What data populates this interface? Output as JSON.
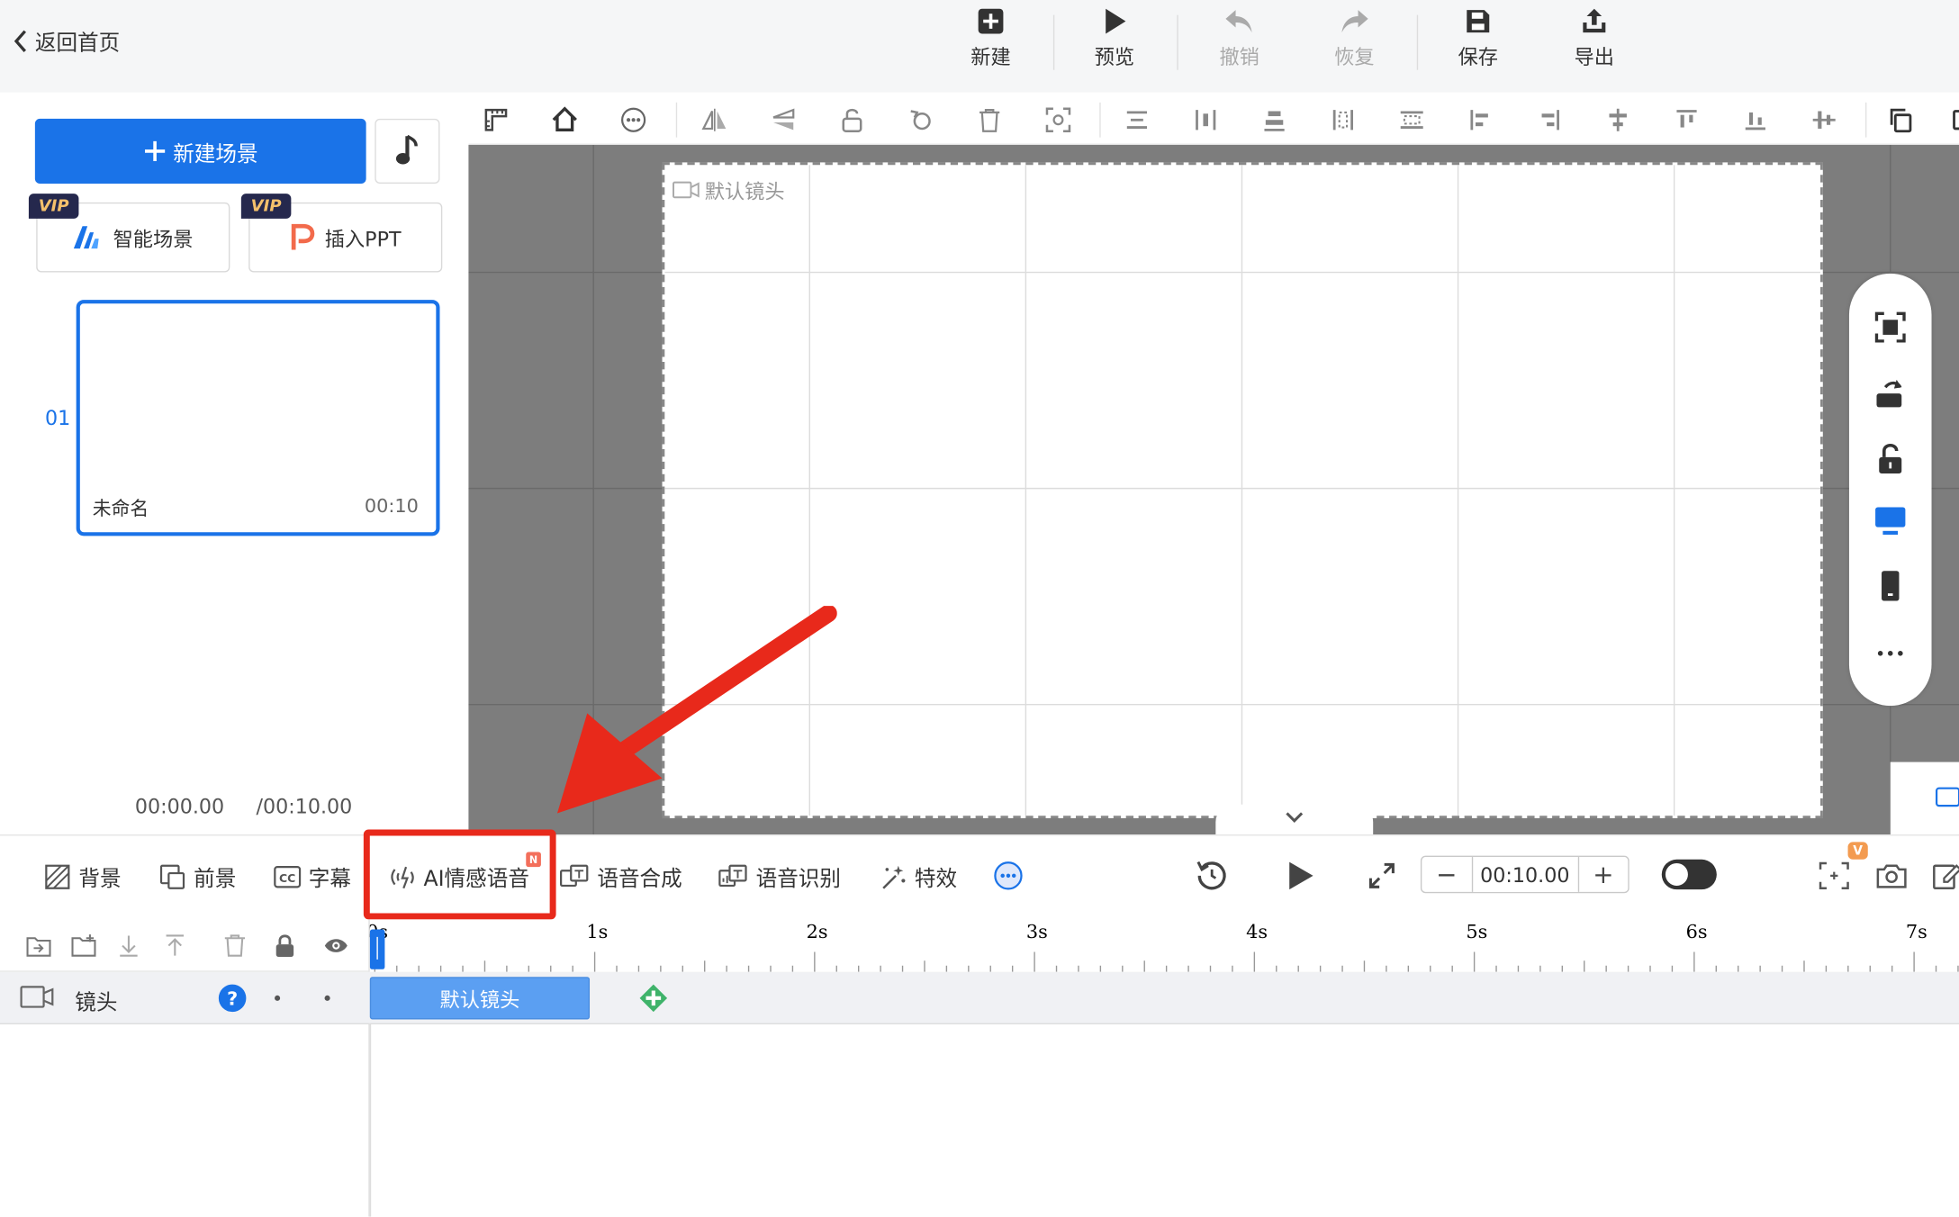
{
  "topbar": {
    "back_label": "返回首页",
    "new_label": "新建",
    "preview_label": "预览",
    "undo_label": "撤销",
    "redo_label": "恢复",
    "save_label": "保存",
    "export_label": "导出"
  },
  "left": {
    "new_scene_label": "新建场景",
    "vip_badge": "VIP",
    "smart_scene_label": "智能场景",
    "insert_ppt_label": "插入PPT",
    "scene": {
      "index": "01",
      "name": "未命名",
      "duration": "00:10"
    },
    "time_current": "00:00.00",
    "time_total": "/00:10.00"
  },
  "canvas": {
    "camera_label": "默认镜头"
  },
  "tabs": {
    "background": "背景",
    "foreground": "前景",
    "subtitle": "字幕",
    "ai_voice": "AI情感语音",
    "ai_voice_badge": "N",
    "tts": "语音合成",
    "asr": "语音识别",
    "effects": "特效"
  },
  "playback": {
    "duration_value": "00:10.00",
    "minus": "−",
    "plus": "+",
    "v_badge": "V"
  },
  "timeline": {
    "track_label": "镜头",
    "clip_label": "默认镜头",
    "ticks": [
      "0s",
      "1s",
      "2s",
      "3s",
      "4s",
      "5s",
      "6s",
      "7s"
    ]
  },
  "colors": {
    "accent": "#1a73e8",
    "highlight": "#e8291b",
    "arrow": "#e8291b",
    "clip": "#5b9ff2"
  }
}
